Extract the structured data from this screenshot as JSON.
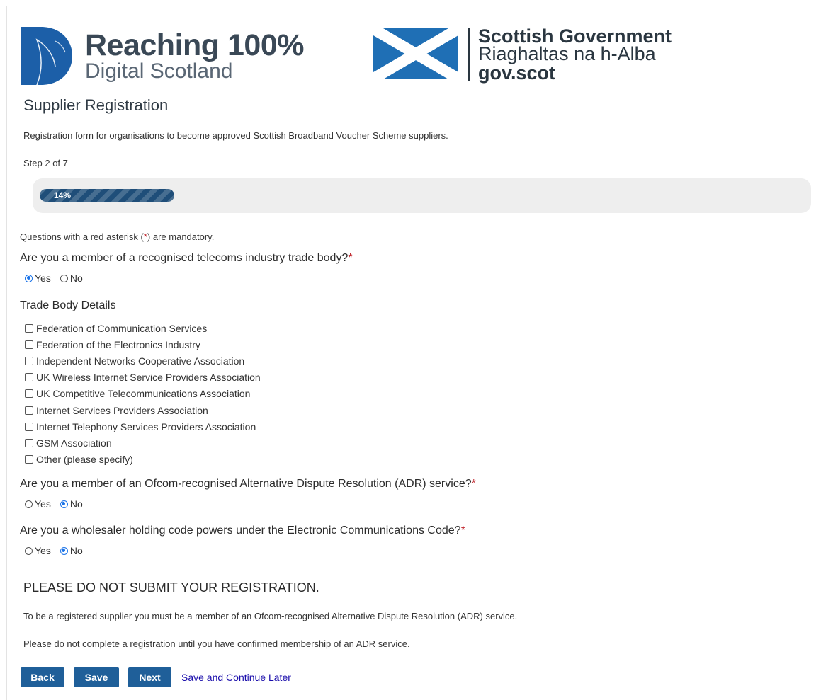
{
  "header": {
    "r100_logo": {
      "line1": "Reaching 100%",
      "line2": "Digital Scotland",
      "icon": "digital-scotland-d-icon",
      "color": "#1c5fa8"
    },
    "sg_logo": {
      "line1": "Scottish Government",
      "line2": "Riaghaltas na h-Alba",
      "line3": "gov.scot",
      "icon": "saltire-flag-icon",
      "flag_color": "#1f6fb5"
    }
  },
  "page": {
    "title": "Supplier Registration",
    "description": "Registration form for organisations to become approved Scottish Broadband Voucher Scheme suppliers.",
    "step": "Step 2 of 7"
  },
  "progress": {
    "percent": 14,
    "label": "14%",
    "color": "#1f4e79"
  },
  "mandatory_note": {
    "before": "Questions with a red asterisk (",
    "asterisk": "*",
    "after": ") are mandatory."
  },
  "questions": {
    "trade_body": {
      "label": "Are you a member of a recognised telecoms industry trade body?",
      "required_mark": "*",
      "options": [
        "Yes",
        "No"
      ],
      "selected": "Yes"
    },
    "trade_body_details": {
      "label": "Trade Body Details",
      "options": [
        "Federation of Communication Services",
        "Federation of the Electronics Industry",
        "Independent Networks Cooperative Association",
        "UK Wireless Internet Service Providers Association",
        "UK Competitive Telecommunications Association",
        "Internet Services Providers Association",
        "Internet Telephony Services Providers Association",
        "GSM Association",
        "Other (please specify)"
      ]
    },
    "adr": {
      "label": "Are you a member of an Ofcom-recognised Alternative Dispute Resolution (ADR) service?",
      "required_mark": "*",
      "options": [
        "Yes",
        "No"
      ],
      "selected": "No"
    },
    "wholesaler": {
      "label": "Are you a wholesaler holding code powers under the Electronic Communications Code?",
      "required_mark": "*",
      "options": [
        "Yes",
        "No"
      ],
      "selected": "No"
    }
  },
  "notice": {
    "title": "PLEASE DO NOT SUBMIT YOUR REGISTRATION.",
    "p1": "To be a registered supplier you must be a member of an Ofcom-recognised Alternative Dispute Resolution (ADR) service.",
    "p2": "Please do not complete a registration until you have confirmed membership of an ADR service."
  },
  "actions": {
    "back": "Back",
    "save": "Save",
    "next": "Next",
    "save_later": "Save and Continue Later",
    "button_color": "#1f5f99"
  },
  "colors": {
    "required": "#c0262d",
    "radio_selected": "#1a73e8",
    "link": "#1a0dab"
  }
}
